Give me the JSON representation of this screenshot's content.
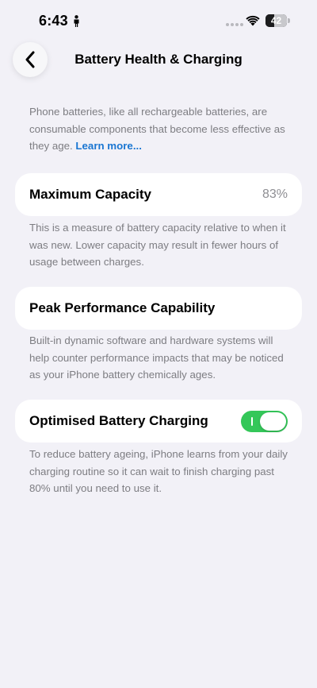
{
  "status_bar": {
    "time": "6:43",
    "battery_level": "42",
    "battery_fraction": 0.42,
    "icons": [
      "person-icon",
      "cellular-signal-icon",
      "wifi-icon",
      "battery-icon"
    ]
  },
  "nav": {
    "back_icon": "chevron-left-icon",
    "title": "Battery Health & Charging"
  },
  "intro": {
    "text": "Phone batteries, like all rechargeable batteries, are consumable components that become less effective as they age. ",
    "link": "Learn more..."
  },
  "maximum_capacity": {
    "label": "Maximum Capacity",
    "value": "83%",
    "description": "This is a measure of battery capacity relative to when it was new. Lower capacity may result in fewer hours of usage between charges."
  },
  "peak_performance": {
    "label": "Peak Performance Capability",
    "description": "Built-in dynamic software and hardware systems will help counter performance impacts that may be noticed as your iPhone battery chemically ages."
  },
  "optimised_charging": {
    "label": "Optimised Battery Charging",
    "enabled": true,
    "description": "To reduce battery ageing, iPhone learns from your daily charging routine so it can wait to finish charging past 80% until you need to use it."
  },
  "colors": {
    "background": "#f2f1f7",
    "toggle_on": "#34c759",
    "link": "#1a76d2",
    "secondary_text": "#7d7d82"
  }
}
